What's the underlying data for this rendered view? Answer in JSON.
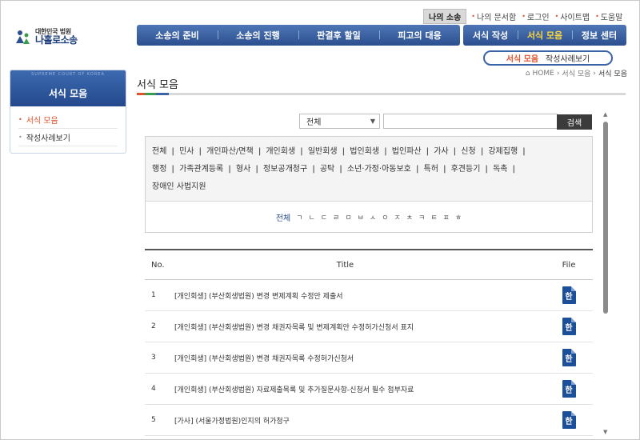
{
  "logo": {
    "small": "대한민국 법원",
    "big": "나홀로소송"
  },
  "util": {
    "mine": "나의 소송",
    "links": [
      "나의 문서함",
      "로그인",
      "사이트맵",
      "도움말"
    ]
  },
  "gnav": [
    "소송의 준비",
    "소송의 진행",
    "판결후 할일",
    "피고의 대응"
  ],
  "gnav2": [
    "서식 작성",
    "서식 모음",
    "정보 센터"
  ],
  "subtabs": [
    "서식 모음",
    "작성사례보기"
  ],
  "breadcrumb": {
    "home": "HOME",
    "mid": "서식 모음",
    "current": "서식 모음"
  },
  "page_title": "서식 모음",
  "lnb": {
    "sub": "SUPREME COURT OF KOREA",
    "title": "서식 모음",
    "items": [
      "서식 모음",
      "작성사례보기"
    ]
  },
  "search": {
    "select": "전체",
    "button": "검색"
  },
  "categories": [
    [
      "전체",
      "민사",
      "개인파산/면책",
      "개인회생",
      "일반회생",
      "법인회생",
      "법인파산",
      "가사",
      "신청",
      "강제집행"
    ],
    [
      "행정",
      "가족관계등록",
      "형사",
      "정보공개청구",
      "공탁",
      "소년·가정·아동보호",
      "특허",
      "후견등기",
      "독촉"
    ],
    [
      "장애인 사법지원"
    ]
  ],
  "consonants": {
    "all": "전체",
    "list": [
      "ㄱ",
      "ㄴ",
      "ㄷ",
      "ㄹ",
      "ㅁ",
      "ㅂ",
      "ㅅ",
      "ㅇ",
      "ㅈ",
      "ㅊ",
      "ㅋ",
      "ㅌ",
      "ㅍ",
      "ㅎ"
    ]
  },
  "table": {
    "headers": {
      "no": "No.",
      "title": "Title",
      "file": "File"
    },
    "file_icon_text": "한",
    "rows": [
      {
        "no": "1",
        "title": "[개인회생] (부산회생법원) 변경 변제계획 수정안 제출서"
      },
      {
        "no": "2",
        "title": "[개인회생] (부산회생법원) 변경 채권자목록 및 변제계획안 수정허가신청서 표지"
      },
      {
        "no": "3",
        "title": "[개인회생] (부산회생법원) 변경 채권자목록 수정허가신청서"
      },
      {
        "no": "4",
        "title": "[개인회생] (부산회생법원) 자료제출목록 및 추가질문사항-신청서 필수 첨부자료"
      },
      {
        "no": "5",
        "title": "[가사] (서울가정법원)인지의 허가청구"
      }
    ]
  },
  "colors": {
    "nav": "#2c4f8e",
    "accent": "#e0522b",
    "active_nav": "#ffd93b"
  }
}
